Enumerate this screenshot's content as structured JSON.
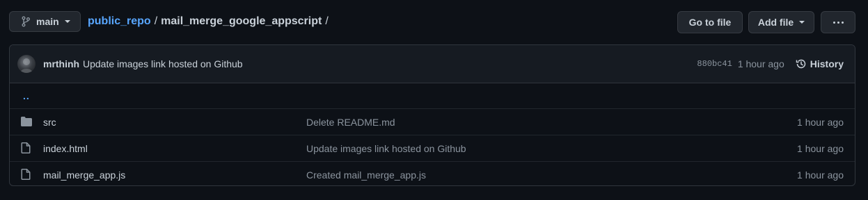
{
  "branch": {
    "label": "main"
  },
  "breadcrumb": {
    "repo": "public_repo",
    "separator": "/",
    "folder": "mail_merge_google_appscript",
    "trailing": "/"
  },
  "buttons": {
    "go_to_file": "Go to file",
    "add_file": "Add file"
  },
  "commit": {
    "author": "mrthinh",
    "message": "Update images link hosted on Github",
    "sha": "880bc41",
    "time": "1 hour ago",
    "history_label": "History"
  },
  "parent_dir": "..",
  "files": [
    {
      "type": "folder",
      "icon": "folder-icon",
      "name": "src",
      "message": "Delete README.md",
      "time": "1 hour ago"
    },
    {
      "type": "file",
      "icon": "file-icon",
      "name": "index.html",
      "message": "Update images link hosted on Github",
      "time": "1 hour ago"
    },
    {
      "type": "file",
      "icon": "file-icon",
      "name": "mail_merge_app.js",
      "message": "Created mail_merge_app.js",
      "time": "1 hour ago"
    }
  ],
  "colors": {
    "background": "#0d1117",
    "link": "#58a6ff",
    "muted": "#8b949e",
    "text": "#c9d1d9",
    "border": "#30363d"
  }
}
